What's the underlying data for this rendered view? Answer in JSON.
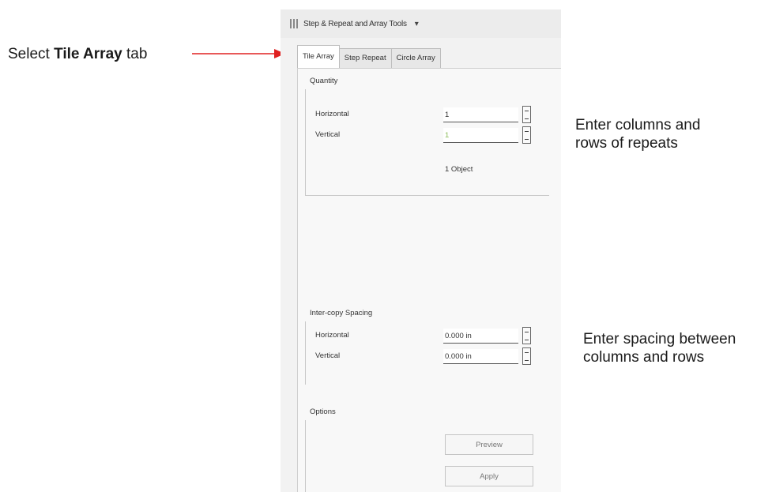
{
  "annotations": {
    "tab_prefix": "Select",
    "tab_bold": "Tile Array",
    "tab_suffix": "tab",
    "quantity_line1": "Enter columns and",
    "quantity_line2": "rows of repeats",
    "spacing_line1": "Enter spacing between",
    "spacing_line2": "columns and rows",
    "arrow_color": "#e02020",
    "brace_color": "#e02020"
  },
  "panel": {
    "title": "Step & Repeat and Array Tools",
    "title_dropdown": "▾",
    "tabs": [
      {
        "label": "Tile Array",
        "active": true
      },
      {
        "label": "Step Repeat",
        "active": false
      },
      {
        "label": "Circle Array",
        "active": false
      }
    ],
    "quantity": {
      "title": "Quantity",
      "horizontal_label": "Horizontal",
      "horizontal_value": "1",
      "vertical_label": "Vertical",
      "vertical_value": "1",
      "object_count": "1 Object"
    },
    "spacing": {
      "title": "Inter-copy Spacing",
      "horizontal_label": "Horizontal",
      "horizontal_value": "0.000 in",
      "vertical_label": "Vertical",
      "vertical_value": "0.000 in"
    },
    "options": {
      "title": "Options",
      "preview_label": "Preview",
      "apply_label": "Apply"
    }
  }
}
